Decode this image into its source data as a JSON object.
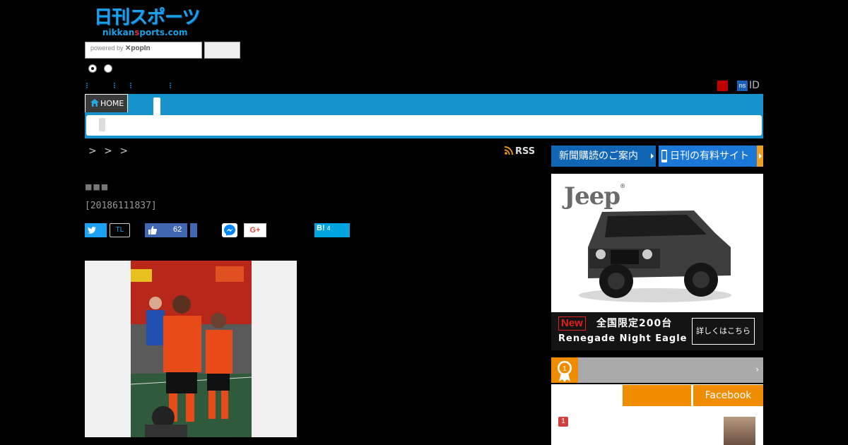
{
  "header": {
    "logo_main": "日刊スポーツ",
    "logo_sub_a": "nikkan",
    "logo_sub_b": "s",
    "logo_sub_c": "ports.com",
    "search_powered": "powered by",
    "search_brand": "✕popIn",
    "id_badge": "ns",
    "id_label": "ID"
  },
  "nav": {
    "home_label": "HOME"
  },
  "breadcrumb": ">  >  >",
  "rss_label": "RSS",
  "article": {
    "dots": "■■■",
    "id": "[20186111837]"
  },
  "share": {
    "tl": "TL",
    "fb_count": "62",
    "gplus": "G+",
    "hatena": "B!",
    "hatena_count": "4"
  },
  "sidebar": {
    "promo_1": "新聞購読のご案内",
    "promo_2": "日刊の有料サイト",
    "ad": {
      "brand": "Jeep",
      "new_badge": "New",
      "headline": "全国限定200台",
      "model": "Renegade Night Eagle",
      "button": "詳しくはこちら"
    },
    "ranking": {
      "rank_1_label": "1",
      "tab_facebook": "Facebook",
      "chevron": "›",
      "item_1_rank": "1"
    }
  },
  "colors": {
    "accent_blue": "#1793cc",
    "orange": "#f08c00",
    "brand_blue": "#1165b5"
  }
}
